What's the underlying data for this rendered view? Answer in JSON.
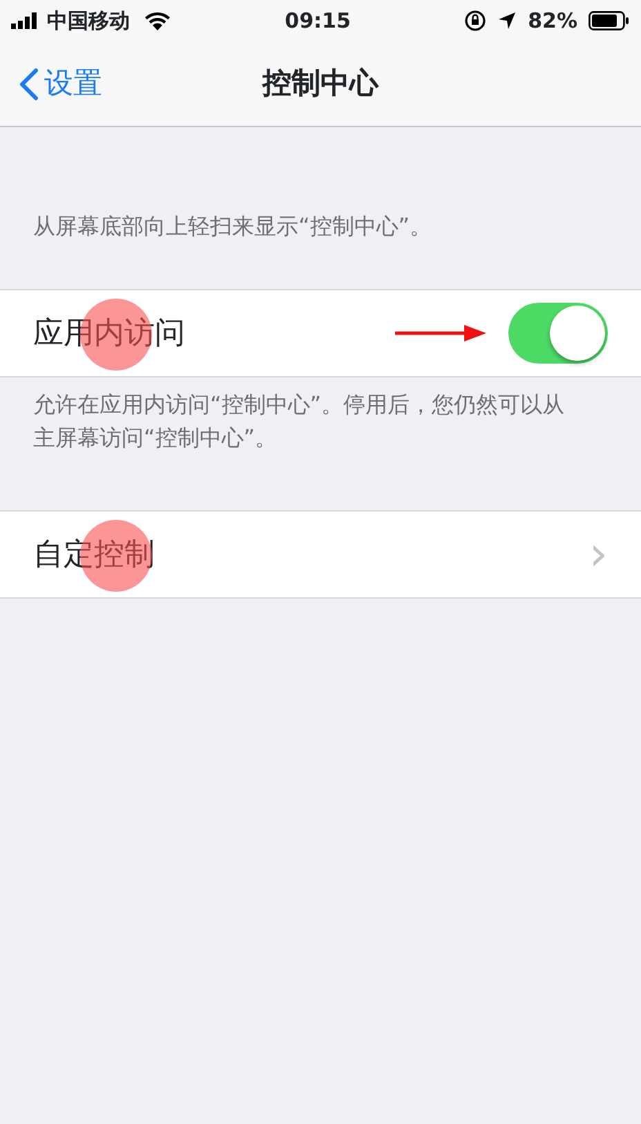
{
  "status_bar": {
    "carrier": "中国移动",
    "time": "09:15",
    "battery": "82%"
  },
  "nav": {
    "back": "设置",
    "title": "控制中心"
  },
  "header_note": "从屏幕底部向上轻扫来显示“控制中心”。",
  "toggle_row": {
    "label": "应用内访问",
    "on": true,
    "tap_marker": true,
    "arrow": true
  },
  "footer_note": "允许在应用内访问“控制中心”。停用后，您仍然可以从主屏幕访问“控制中心”。",
  "link_row": {
    "label": "自定控制",
    "chevron": "›",
    "tap_marker": true
  }
}
